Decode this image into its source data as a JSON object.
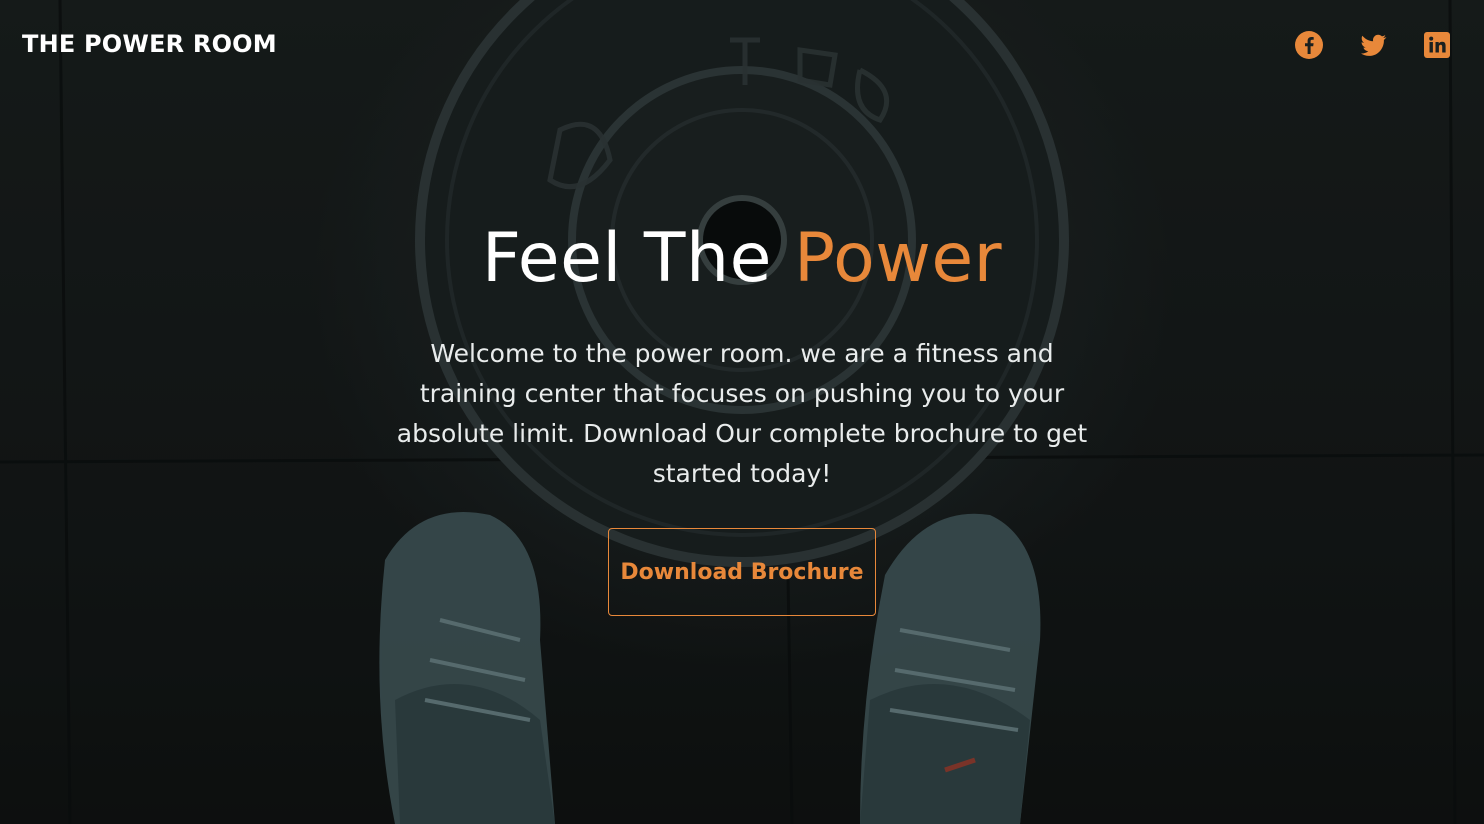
{
  "brand": {
    "name": "THE POWER ROOM"
  },
  "social": {
    "items": [
      {
        "icon": "facebook-icon",
        "label": "Facebook"
      },
      {
        "icon": "twitter-icon",
        "label": "Twitter"
      },
      {
        "icon": "linkedin-icon",
        "label": "LinkedIn"
      }
    ]
  },
  "hero": {
    "headline_main": "Feel The ",
    "headline_accent": "Power",
    "description": "Welcome to the power room. we are a fitness and training center that focuses on pushing you to your absolute limit. Download Our complete brochure to get started today!",
    "cta_label": "Download Brochure"
  },
  "colors": {
    "accent": "#e8883a",
    "text": "#ffffff",
    "background": "#1b2020"
  }
}
